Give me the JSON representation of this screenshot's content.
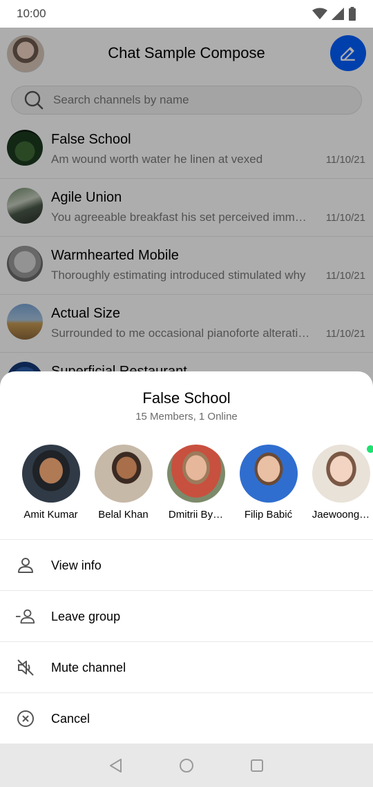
{
  "status_bar": {
    "time": "10:00"
  },
  "header": {
    "title": "Chat Sample Compose"
  },
  "search": {
    "placeholder": "Search channels by name"
  },
  "channels": [
    {
      "name": "False School",
      "message": "Am wound worth water he linen at vexed",
      "date": "11/10/21"
    },
    {
      "name": "Agile Union",
      "message": "You agreeable breakfast his set perceived immediately",
      "date": "11/10/21"
    },
    {
      "name": "Warmhearted Mobile",
      "message": "Thoroughly estimating introduced stimulated why",
      "date": "11/10/21"
    },
    {
      "name": "Actual Size",
      "message": "Surrounded to me occasional pianoforte alteration",
      "date": "11/10/21"
    },
    {
      "name": "Superficial Restaurant",
      "message": "",
      "date": ""
    }
  ],
  "sheet": {
    "title": "False School",
    "subtitle": "15 Members, 1 Online",
    "members": [
      {
        "name": "Amit Kumar",
        "online": false
      },
      {
        "name": "Belal Khan",
        "online": false
      },
      {
        "name": "Dmitrii By…",
        "online": false
      },
      {
        "name": "Filip Babić",
        "online": false
      },
      {
        "name": "Jaewoong…",
        "online": true
      }
    ],
    "actions": [
      {
        "label": "View info",
        "icon": "person-icon"
      },
      {
        "label": "Leave group",
        "icon": "person-remove-icon"
      },
      {
        "label": "Mute channel",
        "icon": "volume-off-icon"
      },
      {
        "label": "Cancel",
        "icon": "cancel-circle-icon"
      }
    ]
  },
  "colors": {
    "accent": "#005fff",
    "online": "#20e070"
  }
}
